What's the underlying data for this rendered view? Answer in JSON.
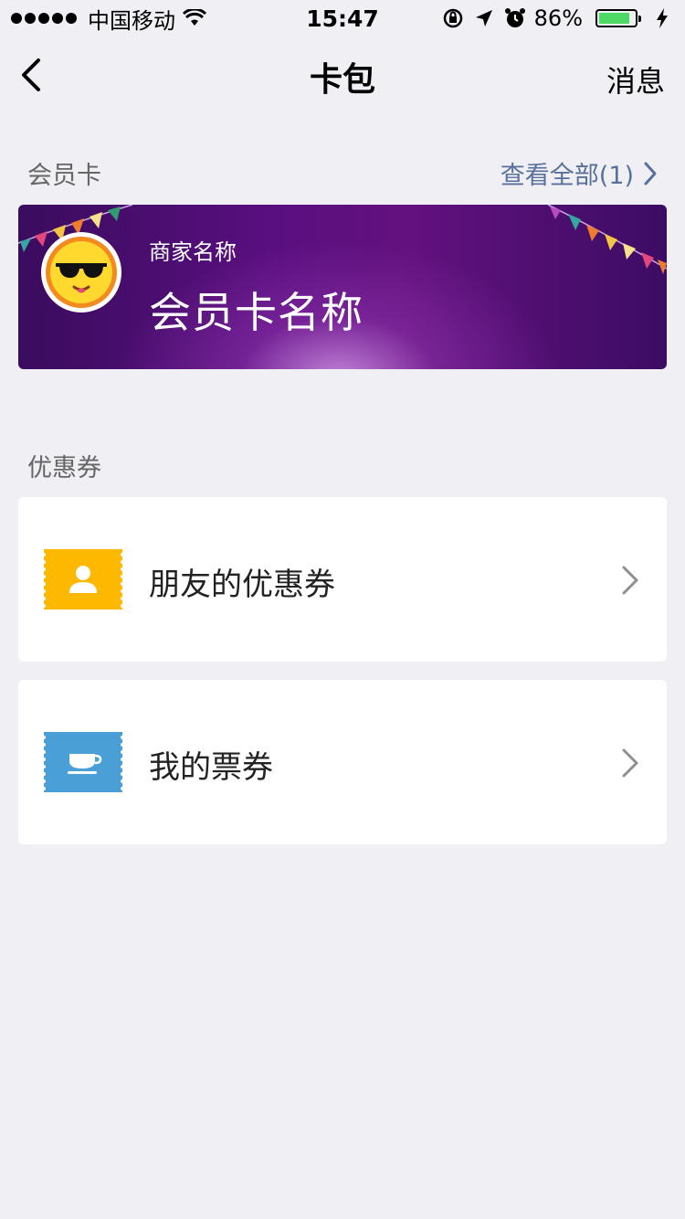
{
  "status_bar": {
    "carrier": "中国移动",
    "time": "15:47",
    "battery": "86%",
    "battery_level": 0.86
  },
  "nav": {
    "title": "卡包",
    "right_label": "消息"
  },
  "member_section": {
    "title": "会员卡",
    "view_all": "查看全部(1)"
  },
  "member_card": {
    "merchant_name": "商家名称",
    "card_name": "会员卡名称"
  },
  "coupon_section": {
    "title": "优惠券"
  },
  "coupons": [
    {
      "label": "朋友的优惠券",
      "icon": "person-ticket-icon",
      "color": "#ffb800"
    },
    {
      "label": "我的票券",
      "icon": "cup-ticket-icon",
      "color": "#4a9fd6"
    }
  ]
}
